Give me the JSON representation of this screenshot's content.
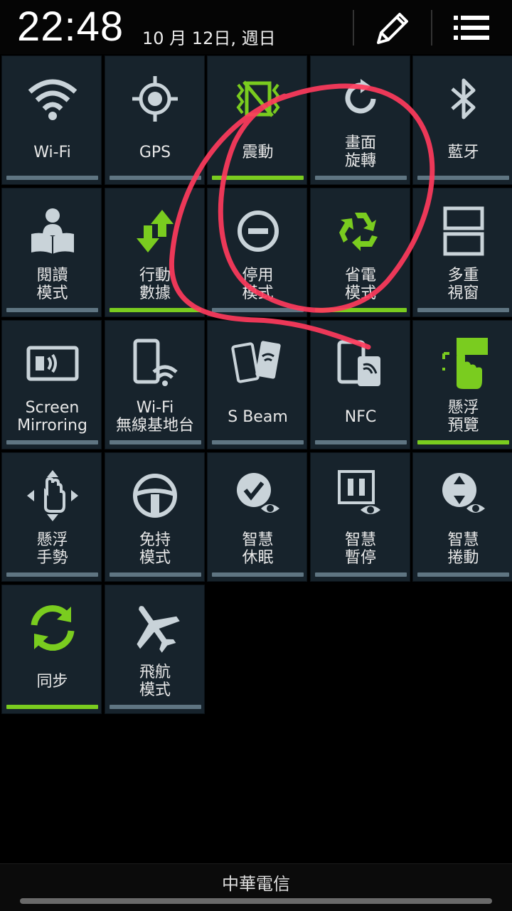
{
  "status": {
    "time": "22:48",
    "date": "10 月 12日, 週日"
  },
  "header_icons": {
    "edit": "edit-icon",
    "list": "list-icon"
  },
  "colors": {
    "tile_bg": "#17232c",
    "bar_on": "#7acc1f",
    "bar_off": "#5f7582",
    "annotation": "#ff3b5c"
  },
  "tiles": [
    {
      "label": "Wi-Fi",
      "icon": "wifi-icon",
      "on": false
    },
    {
      "label": "GPS",
      "icon": "gps-icon",
      "on": false
    },
    {
      "label": "震動",
      "icon": "vibrate-icon",
      "on": true
    },
    {
      "label": "畫面\n旋轉",
      "icon": "rotate-icon",
      "on": false
    },
    {
      "label": "藍牙",
      "icon": "bluetooth-icon",
      "on": false
    },
    {
      "label": "閱讀\n模式",
      "icon": "reading-icon",
      "on": false
    },
    {
      "label": "行動\n數據",
      "icon": "mobile-data-icon",
      "on": true
    },
    {
      "label": "停用\n模式",
      "icon": "block-icon",
      "on": false
    },
    {
      "label": "省電\n模式",
      "icon": "recycle-icon",
      "on": true
    },
    {
      "label": "多重\n視窗",
      "icon": "multi-window-icon",
      "on": false
    },
    {
      "label": "Screen\nMirroring",
      "icon": "screen-mirroring-icon",
      "on": false
    },
    {
      "label": "Wi-Fi\n無線基地台",
      "icon": "hotspot-icon",
      "on": false
    },
    {
      "label": "S Beam",
      "icon": "sbeam-icon",
      "on": false
    },
    {
      "label": "NFC",
      "icon": "nfc-icon",
      "on": false
    },
    {
      "label": "懸浮\n預覽",
      "icon": "air-view-icon",
      "on": true
    },
    {
      "label": "懸浮\n手勢",
      "icon": "air-gesture-icon",
      "on": false
    },
    {
      "label": "免持\n模式",
      "icon": "steering-wheel-icon",
      "on": false
    },
    {
      "label": "智慧\n休眠",
      "icon": "smart-stay-icon",
      "on": false
    },
    {
      "label": "智慧\n暫停",
      "icon": "smart-pause-icon",
      "on": false
    },
    {
      "label": "智慧\n捲動",
      "icon": "smart-scroll-icon",
      "on": false
    },
    {
      "label": "同步",
      "icon": "sync-icon",
      "on": true
    },
    {
      "label": "飛航\n模式",
      "icon": "airplane-icon",
      "on": false
    }
  ],
  "footer": {
    "carrier": "中華電信"
  }
}
